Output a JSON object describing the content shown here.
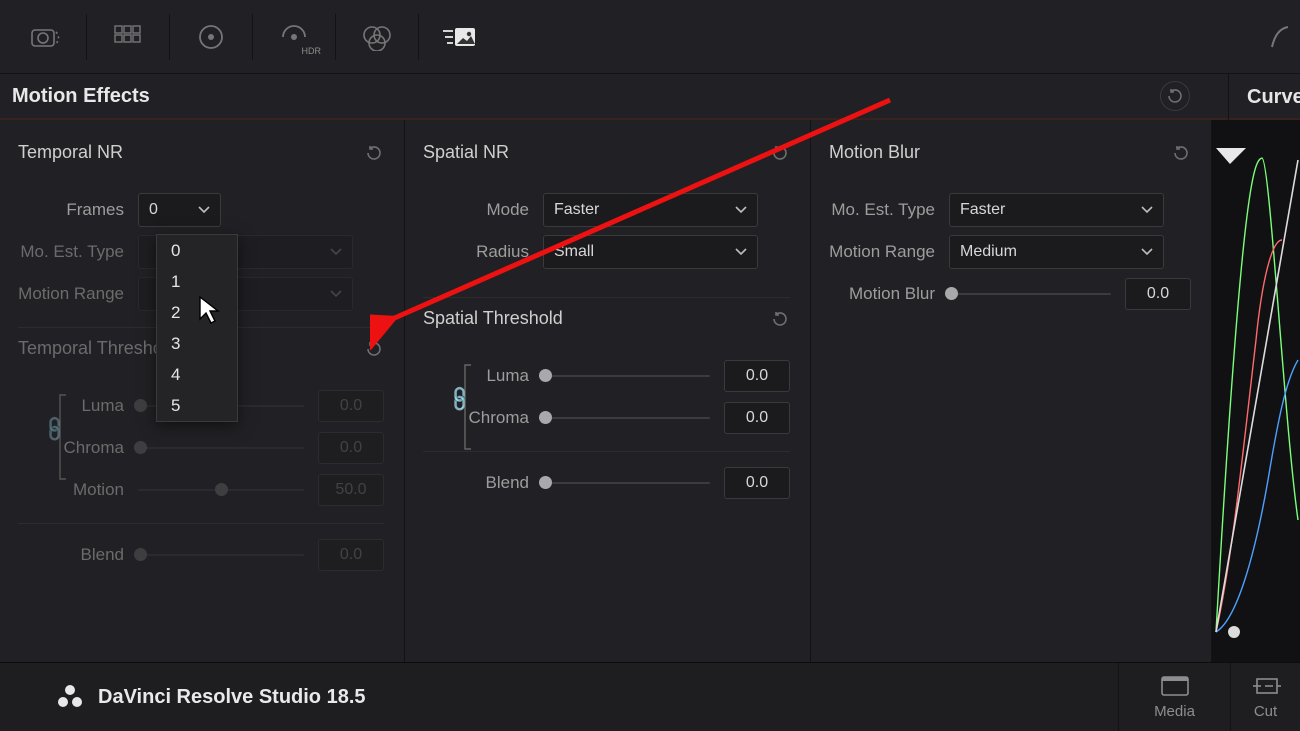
{
  "toolbar": {
    "hdr_label": "HDR"
  },
  "header": {
    "title": "Motion Effects",
    "curves_label": "Curves"
  },
  "temporal": {
    "title": "Temporal NR",
    "frames_label": "Frames",
    "frames_value": "0",
    "frames_options": [
      "0",
      "1",
      "2",
      "3",
      "4",
      "5"
    ],
    "mo_est_label": "Mo. Est. Type",
    "mo_est_value": "",
    "motion_range_label": "Motion Range",
    "motion_range_value": "",
    "threshold_title": "Temporal Threshold",
    "luma_label": "Luma",
    "luma_value": "0.0",
    "chroma_label": "Chroma",
    "chroma_value": "0.0",
    "motion_label": "Motion",
    "motion_value": "50.0",
    "blend_label": "Blend",
    "blend_value": "0.0"
  },
  "spatial": {
    "title": "Spatial NR",
    "mode_label": "Mode",
    "mode_value": "Faster",
    "radius_label": "Radius",
    "radius_value": "Small",
    "threshold_title": "Spatial Threshold",
    "luma_label": "Luma",
    "luma_value": "0.0",
    "chroma_label": "Chroma",
    "chroma_value": "0.0",
    "blend_label": "Blend",
    "blend_value": "0.0"
  },
  "motionblur": {
    "title": "Motion Blur",
    "mo_est_label": "Mo. Est. Type",
    "mo_est_value": "Faster",
    "motion_range_label": "Motion Range",
    "motion_range_value": "Medium",
    "motion_blur_label": "Motion Blur",
    "motion_blur_value": "0.0"
  },
  "bottom": {
    "app_name": "DaVinci Resolve Studio 18.5",
    "tab_media": "Media",
    "tab_cut": "Cut"
  }
}
